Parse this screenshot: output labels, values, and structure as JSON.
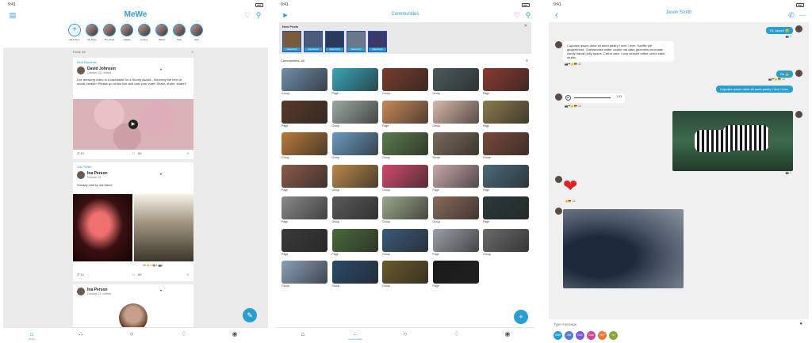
{
  "feed_screen": {
    "time": "9:41",
    "logo": "MeWe",
    "stories": [
      {
        "name": "Add Story"
      },
      {
        "name": "My Story"
      },
      {
        "name": "The Rock"
      },
      {
        "name": "mattlee"
      },
      {
        "name": "jeremy"
      },
      {
        "name": "Marta"
      },
      {
        "name": "Kelly"
      },
      {
        "name": "Sam"
      }
    ],
    "filter": "Feed: All",
    "posts": [
      {
        "group": "Blue Bananas",
        "author": "David Johnson",
        "date": "October 23 • edited",
        "text": "Our amazing video is a candidate for a Shorty Award - honoring the best of social media!!! Please go to this link and cast your vote!! Share, share, share!!",
        "shares": "10",
        "comments": "89"
      },
      {
        "group": "Girl Power",
        "author": "Ina Person",
        "date": "October 23",
        "text": "Sunday visit by old friend",
        "reactions": [
          "40",
          "1",
          "1",
          "1"
        ],
        "shares": "12",
        "comments": "89"
      },
      {
        "author": "Ina Person",
        "date": "October 23 • edited"
      }
    ],
    "tabs": [
      {
        "label": "Home",
        "icon": "home-icon",
        "active": true
      },
      {
        "label": "",
        "icon": "communities-icon"
      },
      {
        "label": "",
        "icon": "chat-icon"
      },
      {
        "label": "",
        "icon": "bell-icon"
      },
      {
        "label": "",
        "icon": "profile-icon"
      }
    ]
  },
  "communities_screen": {
    "time": "9:41",
    "title": "Communities",
    "new_posts_label": "New Posts",
    "new_post_badge": "New Post",
    "new_posts_count": 5,
    "header": "Communities: All",
    "tiles": [
      {
        "label": "Group",
        "color": "#6f8fa8"
      },
      {
        "label": "Page",
        "color": "#38a6b8"
      },
      {
        "label": "Group",
        "color": "#7a3c2a"
      },
      {
        "label": "Group",
        "color": "#4b5b5e"
      },
      {
        "label": "Page",
        "color": "#8a3a2e"
      },
      {
        "label": "Page",
        "color": "#5a3a2a"
      },
      {
        "label": "Group",
        "color": "#9aa8a0"
      },
      {
        "label": "Page",
        "color": "#c98858"
      },
      {
        "label": "Group",
        "color": "#d8b8a8"
      },
      {
        "label": "Page",
        "color": "#8a7a4a"
      },
      {
        "label": "Group",
        "color": "#b87a3a"
      },
      {
        "label": "Group",
        "color": "#6a9ac0"
      },
      {
        "label": "Group",
        "color": "#5a7a4a"
      },
      {
        "label": "Group",
        "color": "#7a6a5a"
      },
      {
        "label": "Group",
        "color": "#7a4a3a"
      },
      {
        "label": "Page",
        "color": "#8a5a4a"
      },
      {
        "label": "Group",
        "color": "#b8884a"
      },
      {
        "label": "Group",
        "color": "#d04a6a"
      },
      {
        "label": "Page",
        "color": "#c8a8a8"
      },
      {
        "label": "Page",
        "color": "#4a6a7a"
      },
      {
        "label": "Page",
        "color": "#8a8a8a"
      },
      {
        "label": "Group",
        "color": "#5a5a5a"
      },
      {
        "label": "Group",
        "color": "#9aa88a"
      },
      {
        "label": "Group",
        "color": "#8a6a5a"
      },
      {
        "label": "Page",
        "color": "#2a3a3a"
      },
      {
        "label": "Page",
        "color": "#3a3a3a"
      },
      {
        "label": "Page",
        "color": "#4a6a3a"
      },
      {
        "label": "Group",
        "color": "#3a5a7a"
      },
      {
        "label": "Page",
        "color": "#9aa0a8"
      },
      {
        "label": "Group",
        "color": "#6a6a6a"
      },
      {
        "label": "Group",
        "color": "#8aa0b8"
      },
      {
        "label": "Group",
        "color": "#2a4a6a"
      },
      {
        "label": "Group",
        "color": "#6a5a2a"
      },
      {
        "label": "Page",
        "color": "#1a1a1a"
      }
    ],
    "tabs": [
      {
        "label": "",
        "icon": "home-icon"
      },
      {
        "label": "Communities",
        "icon": "communities-icon",
        "active": true
      },
      {
        "label": "",
        "icon": "chat-icon"
      },
      {
        "label": "",
        "icon": "bell-icon"
      },
      {
        "label": "",
        "icon": "profile-icon"
      }
    ]
  },
  "chat_screen": {
    "time": "9:41",
    "contact": "Jason Smith",
    "messages": [
      {
        "dir": "out",
        "text": "Hi, Jason! 😊",
        "reacts": "1"
      },
      {
        "dir": "in",
        "text": "Cupcake ipsum dolor sit amet pastry I love I love. Soufflé pie gingerbread. Cheesecake wafer cookie oat cake gummies chocolate candy halvah jelly beans. Carrot cake I love dessert toffee carrot cake muffin.",
        "reacts": "12"
      },
      {
        "dir": "out",
        "text": "Ok 👍",
        "reacts": "12"
      },
      {
        "dir": "out",
        "text": "Cupcake ipsum dolor sit amet pastry I love I love."
      },
      {
        "dir": "in",
        "type": "voice",
        "duration": "1:33",
        "reacts": "12"
      },
      {
        "dir": "out",
        "type": "image",
        "reacts": "1"
      },
      {
        "dir": "in",
        "type": "heart",
        "reacts": "12"
      },
      {
        "dir": "in",
        "type": "image"
      }
    ],
    "composer_placeholder": "Type message",
    "options": [
      {
        "label": "Hide",
        "color": "#2b9ed1"
      },
      {
        "label": "Vid",
        "color": "#5a7ad8"
      },
      {
        "label": "Doc",
        "color": "#7a5ad8"
      },
      {
        "label": "Cam",
        "color": "#c84a9a"
      },
      {
        "label": "GIF",
        "color": "#e87a3a"
      },
      {
        "label": "•••",
        "color": "#8aa83a"
      }
    ]
  }
}
